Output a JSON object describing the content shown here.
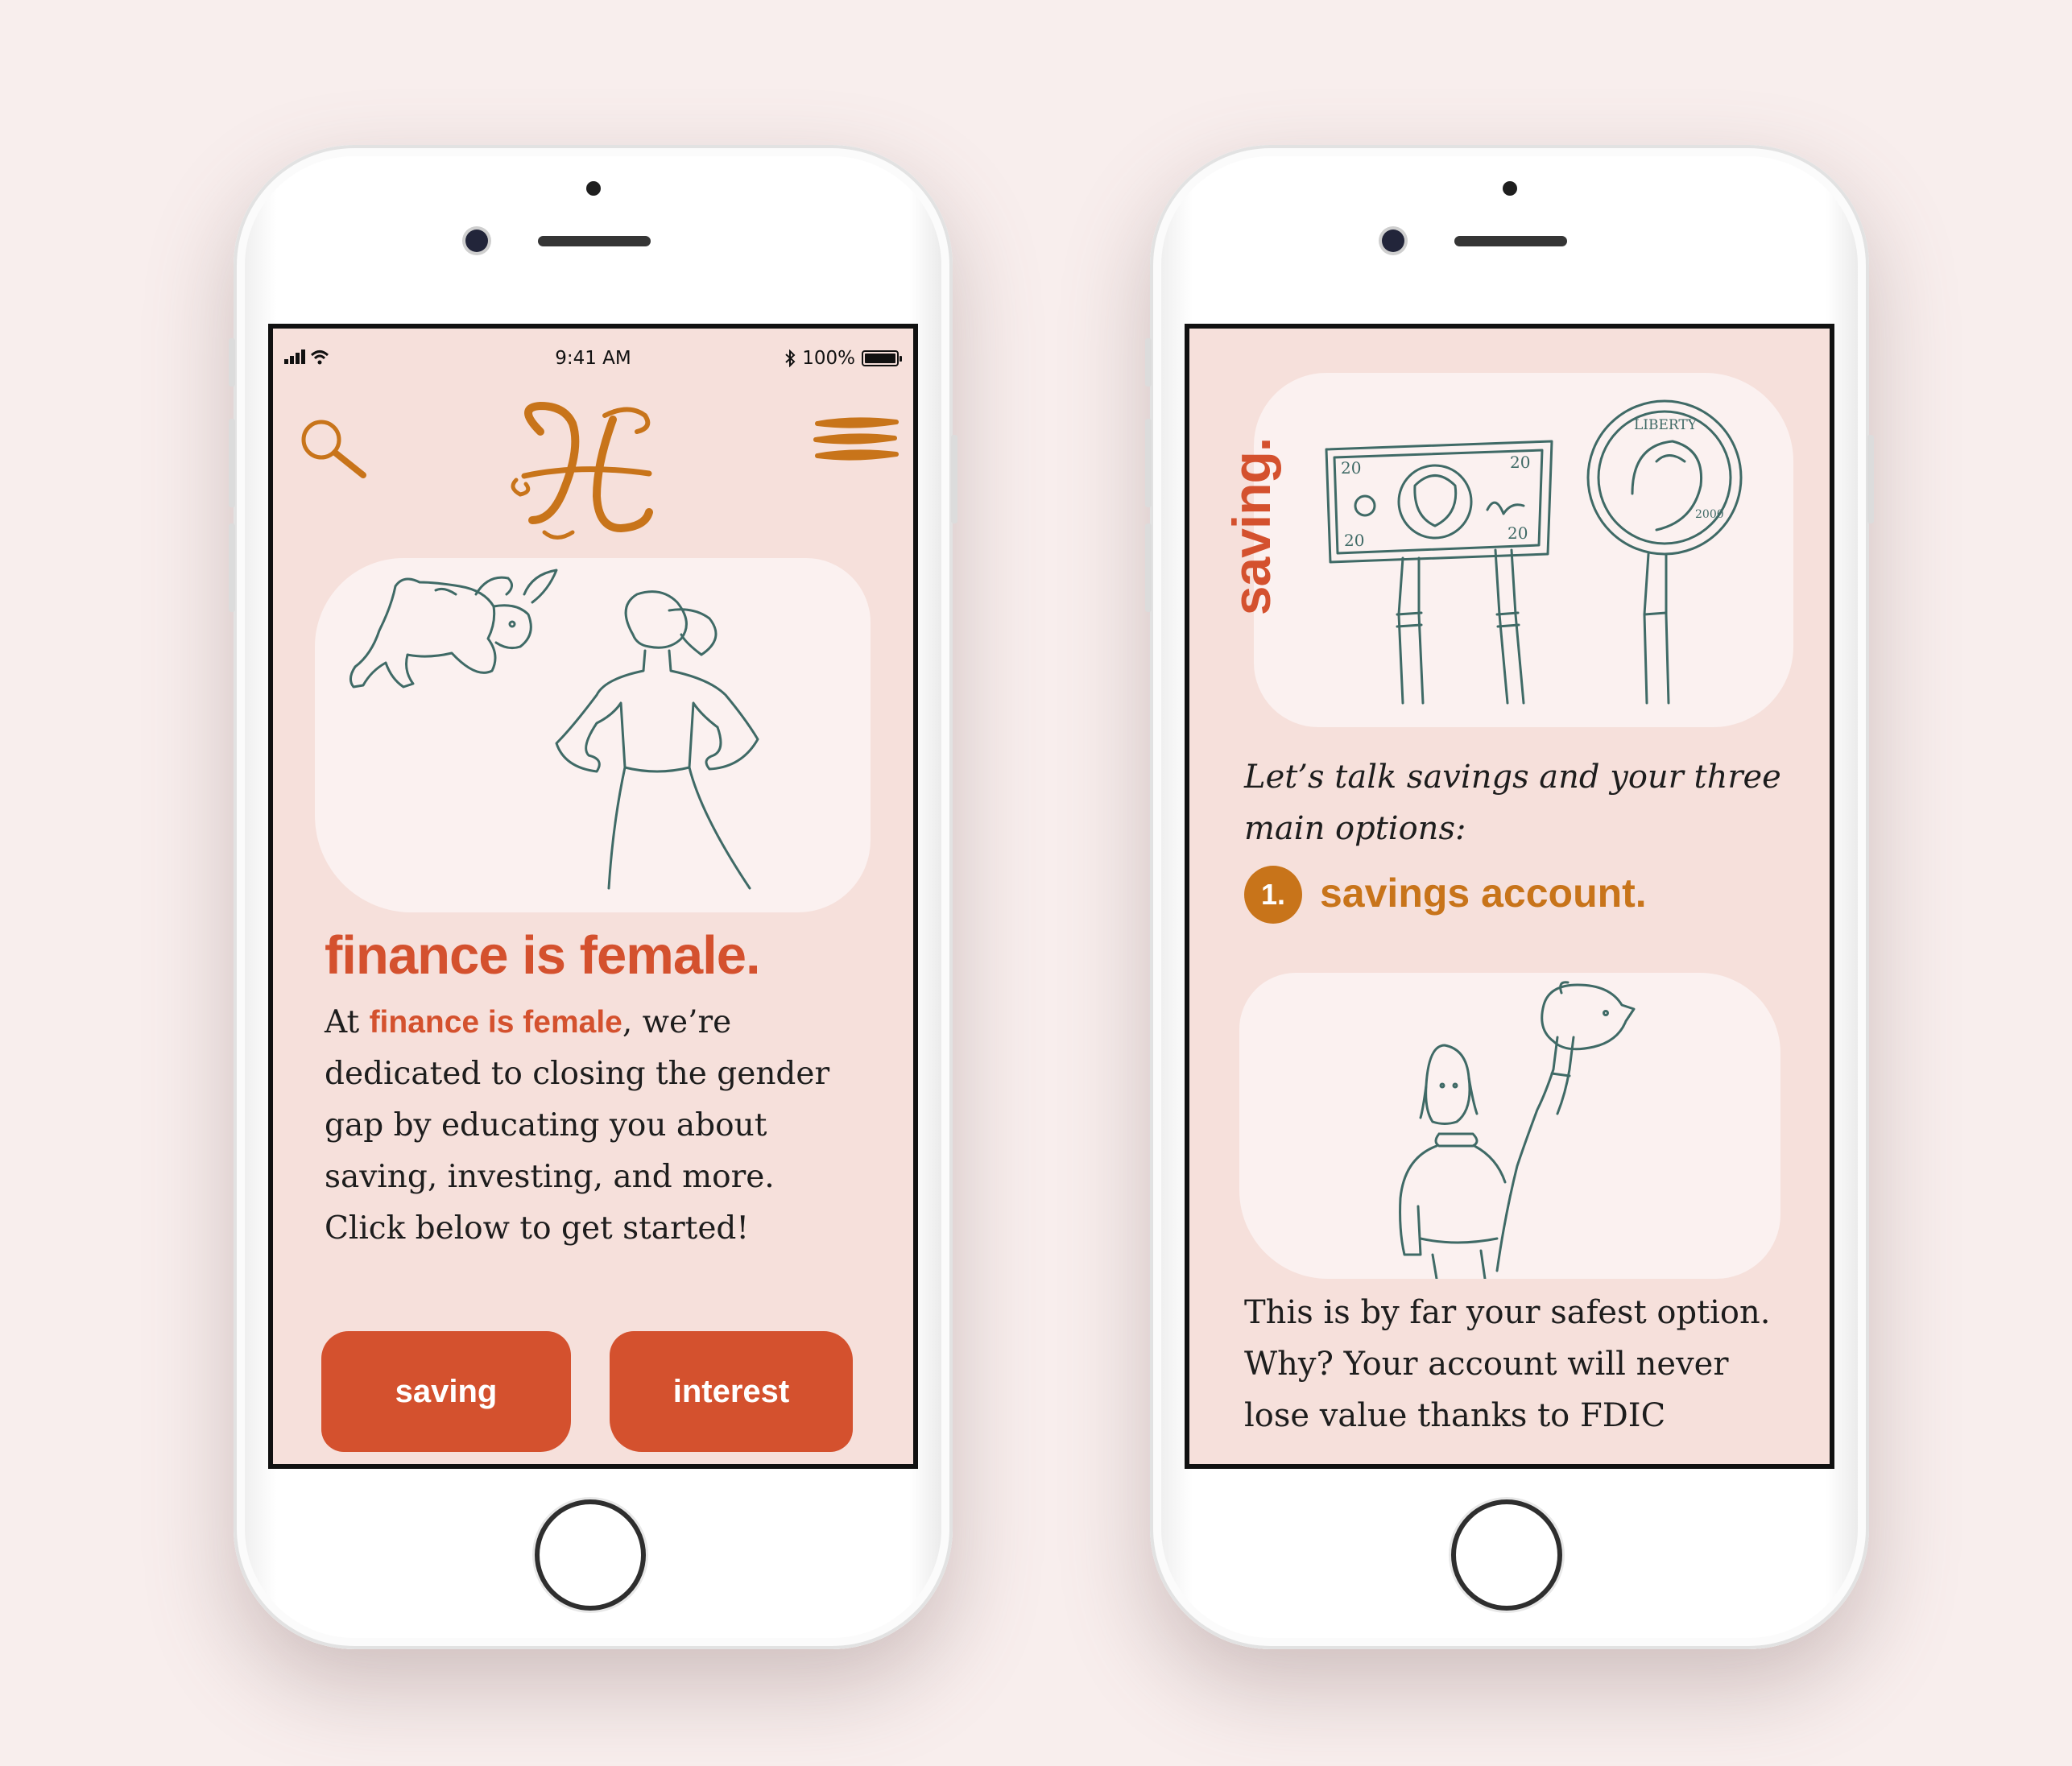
{
  "colors": {
    "background": "#f8eeed",
    "screen_bg": "#f6e0db",
    "card_bg": "#fbf1f0",
    "accent_red": "#d4512e",
    "accent_gold": "#c8741a",
    "line_art": "#3f6a66"
  },
  "phone1": {
    "status_bar": {
      "time": "9:41 AM",
      "battery": "100%"
    },
    "header": {
      "search_icon": "search-icon",
      "logo": "ff-monogram-logo",
      "menu_icon": "menu-icon"
    },
    "hero_illustration": "bull-and-woman-illustration",
    "title": "finance is female.",
    "intro": {
      "prefix": "At ",
      "brand": "finance is female",
      "line1_suffix": ", we’re",
      "line2": "dedicated to closing the gender",
      "line3": "gap by educating you about",
      "line4": "saving, investing, and more.",
      "line5": "Click below to get started!"
    },
    "buttons": {
      "saving": "saving",
      "interest": "interest"
    }
  },
  "phone2": {
    "side_title": "saving.",
    "hero_illustration": "bill-and-coin-illustration",
    "bill_labels": {
      "denomination": "20"
    },
    "coin_labels": {
      "top": "LIBERTY",
      "year": "2000"
    },
    "intro_line1": "Let’s talk savings and your three",
    "intro_line2": "main options:",
    "option": {
      "number": "1.",
      "label": "savings account."
    },
    "option_illustration": "piggy-bank-illustration",
    "body_line1": "This is by far your safest option.",
    "body_line2": "Why? Your account will never",
    "body_line3": "lose value thanks to FDIC"
  }
}
